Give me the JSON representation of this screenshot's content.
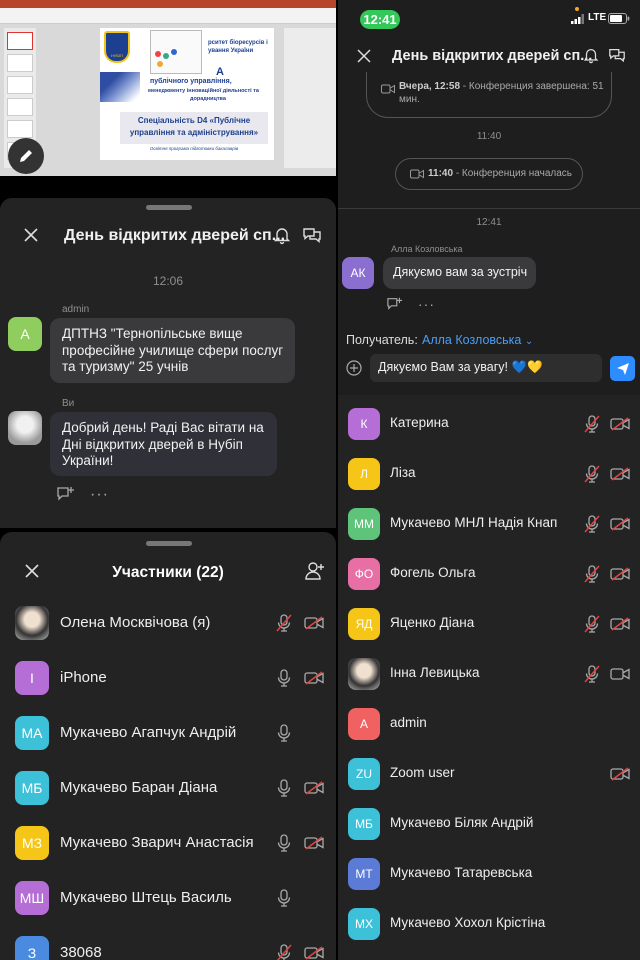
{
  "slide": {
    "header_line1": "рситет біоресурсів і",
    "header_line2": "ування України",
    "logo_text": "НУБІП",
    "letter": "А",
    "line_a": "публічного управління,",
    "line_b": "менеджменту інноваційної діяльності та",
    "line_c": "дорадництва",
    "spec_line1": "Спеціальність D4 «Публічне",
    "spec_line2": "управління та адміністрування»",
    "program": "Освітня програма підготовки бакалаврів"
  },
  "left_chat": {
    "title": "День відкритих дверей сп...",
    "time": "12:06",
    "messages": [
      {
        "sender": "admin",
        "initial": "A",
        "text": "ДПТНЗ \"Тернопільське вище професійне училище сфери послуг та туризму\" 25 учнів"
      },
      {
        "sender": "Ви",
        "text": "Добрий день! Раді Вас вітати на Дні відкритих дверей в Нубіп України!"
      }
    ]
  },
  "participants": {
    "title": "Участники (22)",
    "items": [
      {
        "name": "Олена Москвічова (я)",
        "initials": "",
        "color": "#888888",
        "mic": "off",
        "cam": "off"
      },
      {
        "name": "iPhone",
        "initials": "I",
        "color": "#b56ed6",
        "mic": "on",
        "cam": "off"
      },
      {
        "name": "Мукачево Агапчук Андрій",
        "initials": "МА",
        "color": "#3cc1d8",
        "mic": "on",
        "cam": "none"
      },
      {
        "name": "Мукачево Баран Діана",
        "initials": "МБ",
        "color": "#3cc1d8",
        "mic": "on",
        "cam": "off"
      },
      {
        "name": "Мукачево Зварич Анастасія",
        "initials": "МЗ",
        "color": "#f5c518",
        "mic": "on",
        "cam": "off"
      },
      {
        "name": "Мукачево Штець Василь",
        "initials": "МШ",
        "color": "#b56ed6",
        "mic": "on",
        "cam": "none"
      },
      {
        "name": "38068",
        "initials": "З",
        "color": "#4a8be0",
        "mic": "off",
        "cam": "off"
      }
    ]
  },
  "status_bar": {
    "time": "12:41",
    "network": "LTE"
  },
  "right_chat": {
    "title": "День відкритих дверей сп...",
    "ended_label": "Вчера, 12:58",
    "ended_text": "- Конференция завершена: 51 мин.",
    "time1": "11:40",
    "started_label": "11:40",
    "started_text": "- Конференция началась",
    "time2": "12:41",
    "sender": "Алла Козловська",
    "sender_initials": "АК",
    "message": "Дякуємо вам за зустріч",
    "recipient_label": "Получатель:",
    "recipient": "Алла Козловська",
    "input_value": "Дякуємо Вам за увагу! 💙💛"
  },
  "right_list": {
    "items": [
      {
        "name": "Катерина",
        "initials": "К",
        "color": "#b56ed6",
        "mic": "off",
        "cam": "off"
      },
      {
        "name": "Ліза",
        "initials": "Л",
        "color": "#f5c518",
        "mic": "off",
        "cam": "off"
      },
      {
        "name": "Мукачево МНЛ Надія Кнап",
        "initials": "ММ",
        "color": "#5ec47a",
        "mic": "off",
        "cam": "off"
      },
      {
        "name": "Фогель Ольга",
        "initials": "ФО",
        "color": "#e86fa6",
        "mic": "off",
        "cam": "off"
      },
      {
        "name": "Яценко Діана",
        "initials": "ЯД",
        "color": "#f5c518",
        "mic": "off",
        "cam": "off"
      },
      {
        "name": "Інна Левицька",
        "initials": "",
        "color": "#555555",
        "mic": "off",
        "cam": "on"
      },
      {
        "name": "admin",
        "initials": "A",
        "color": "#f06262",
        "mic": "none",
        "cam": "none"
      },
      {
        "name": "Zoom user",
        "initials": "ZU",
        "color": "#3cc1d8",
        "mic": "none",
        "cam": "off"
      },
      {
        "name": "Мукачево Біляк Андрій",
        "initials": "МБ",
        "color": "#3cc1d8",
        "mic": "none",
        "cam": "none"
      },
      {
        "name": "Мукачево Татаревська",
        "initials": "МТ",
        "color": "#5b7bd6",
        "mic": "none",
        "cam": "none"
      },
      {
        "name": "Мукачево Хохол Крістіна",
        "initials": "МХ",
        "color": "#3cc1d8",
        "mic": "none",
        "cam": "none"
      }
    ]
  },
  "colors": {
    "accent": "#4a9ff5",
    "send": "#2d8cff",
    "panel": "#232323",
    "bubble": "#3a3a3c"
  }
}
